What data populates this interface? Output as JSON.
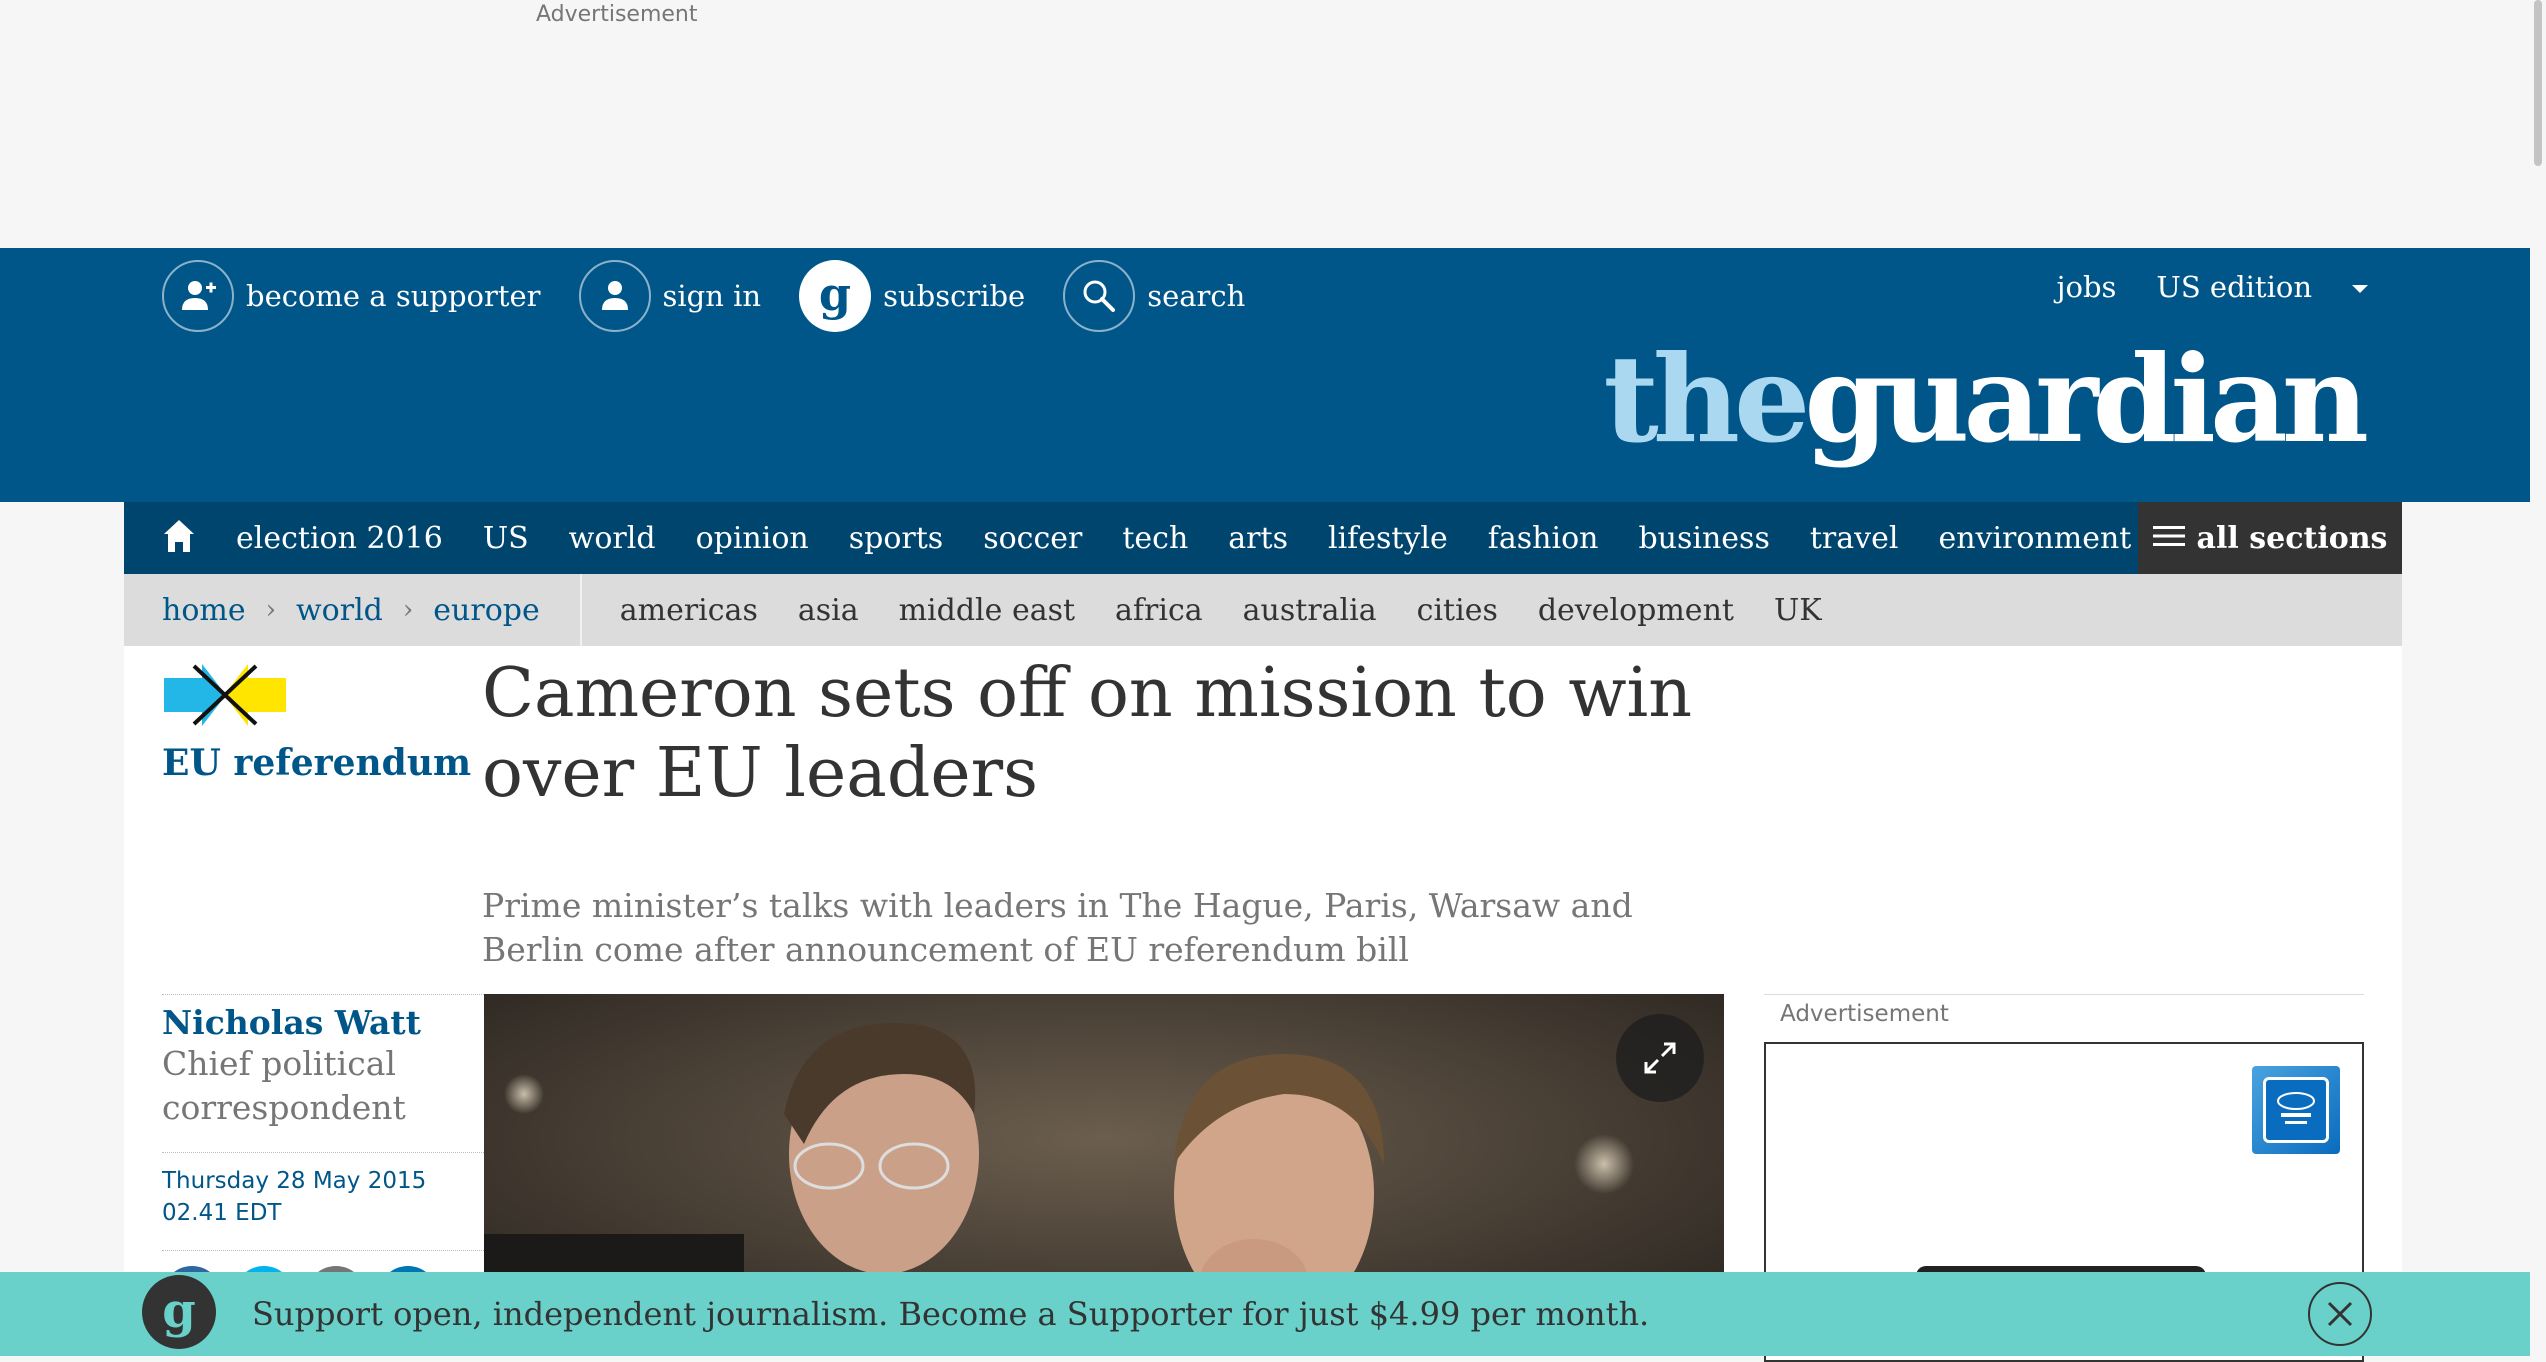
{
  "top_ad": {
    "label": "Advertisement"
  },
  "header": {
    "links": [
      {
        "label": "become a supporter",
        "icon": "add-person-icon"
      },
      {
        "label": "sign in",
        "icon": "person-icon"
      },
      {
        "label": "subscribe",
        "icon": "guardian-g-icon"
      },
      {
        "label": "search",
        "icon": "search-icon"
      }
    ],
    "jobs": "jobs",
    "edition": "US edition",
    "logo_the": "the",
    "logo_guardian": "guardian"
  },
  "nav": {
    "items": [
      "election 2016",
      "US",
      "world",
      "opinion",
      "sports",
      "soccer",
      "tech",
      "arts",
      "lifestyle",
      "fashion",
      "business",
      "travel",
      "environment"
    ],
    "all_sections": "all sections"
  },
  "subnav": {
    "breadcrumbs": [
      "home",
      "world",
      "europe"
    ],
    "separator": "›",
    "items": [
      "americas",
      "asia",
      "middle east",
      "africa",
      "australia",
      "cities",
      "development",
      "UK"
    ]
  },
  "article": {
    "series": "EU referendum",
    "headline": "Cameron sets off on mission to win over EU leaders",
    "standfirst": "Prime minister’s talks with leaders in The Hague, Paris, Warsaw and Berlin come after announcement of EU referendum bill",
    "author": "Nicholas Watt",
    "author_role": "Chief political correspondent",
    "date": "Thursday 28 May 2015",
    "time": "02.41 EDT"
  },
  "side_ad": {
    "label": "Advertisement"
  },
  "support_banner": {
    "text": "Support open, independent journalism. Become a Supporter for just $4.99 per month."
  },
  "colors": {
    "brand_blue": "#005689",
    "nav_blue": "#00456e",
    "support_teal": "#69d1ca",
    "logo_light": "#aad8f1"
  }
}
